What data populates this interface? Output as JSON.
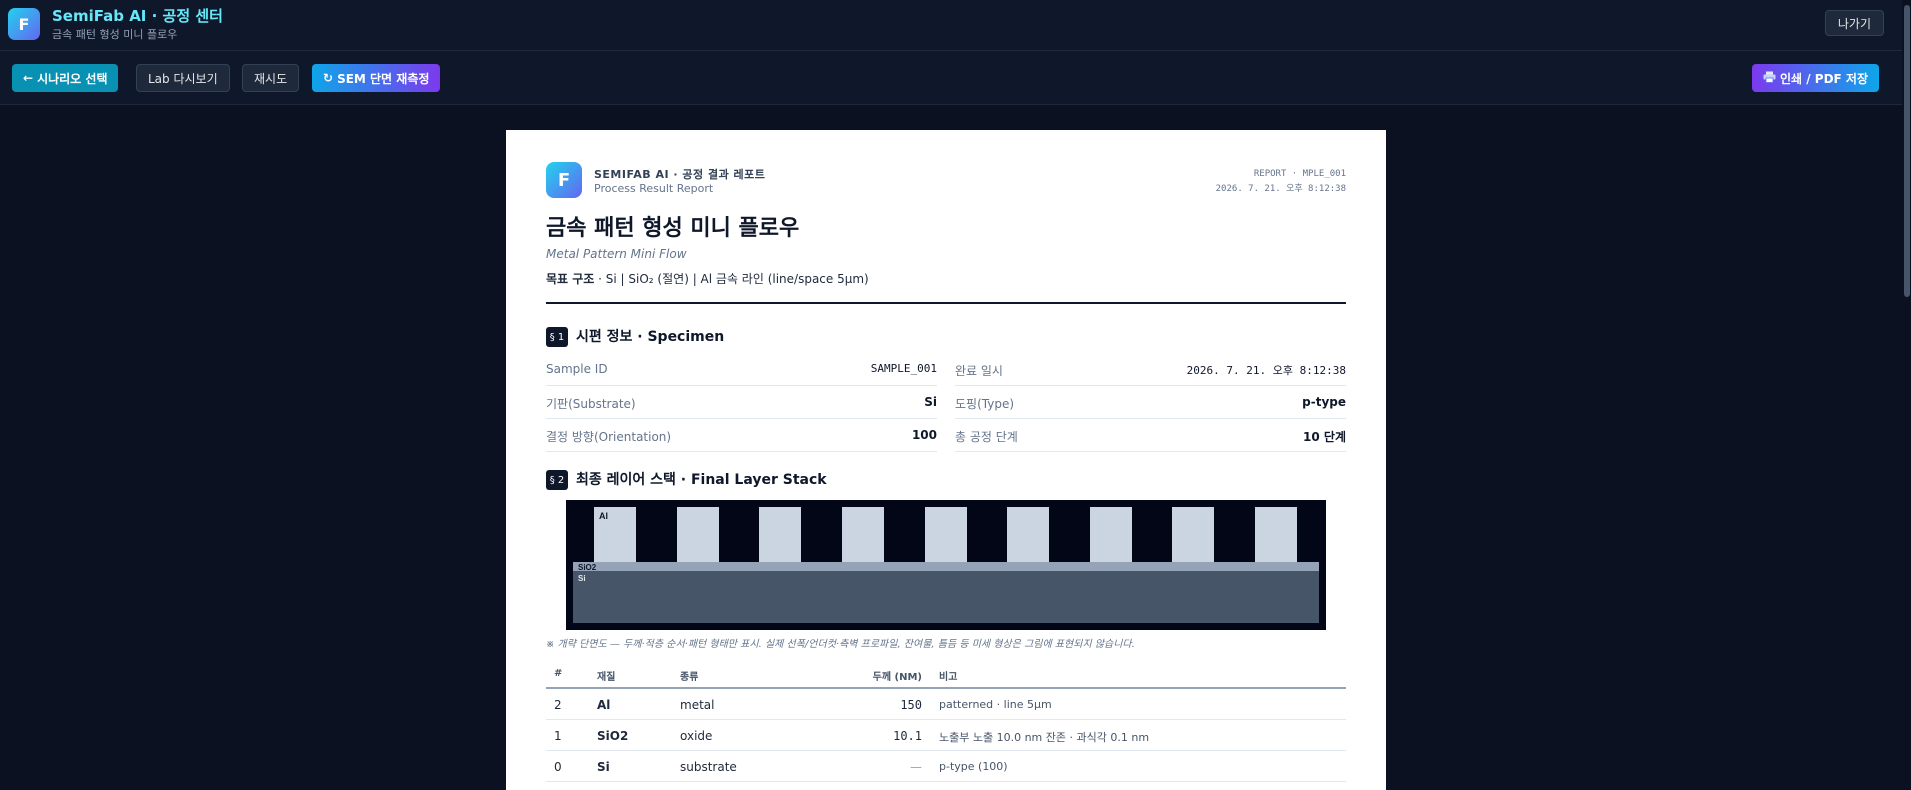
{
  "app": {
    "logo_letter": "F",
    "title": "SemiFab AI · 공정 센터",
    "subtitle": "금속 패턴 형성 미니 플로우",
    "exit_label": "나가기"
  },
  "toolbar": {
    "scenario_icon": "←",
    "scenario_label": "시나리오 선택",
    "lab_label": "Lab 다시보기",
    "retry_label": "재시도",
    "sem_icon": "↻",
    "sem_label": "SEM 단면 재측정",
    "print_icon": "printer-icon",
    "print_label": "인쇄 / PDF 저장"
  },
  "report": {
    "logo_letter": "F",
    "brand": "SEMIFAB AI · 공정 결과 레포트",
    "brand_sub": "Process Result Report",
    "report_id": "REPORT · MPLE_001",
    "timestamp": "2026. 7. 21. 오후 8:12:38",
    "title": "금속 패턴 형성 미니 플로우",
    "title_en": "Metal Pattern Mini Flow",
    "target_label": "목표 구조",
    "target_value": " · Si | SiO₂ (절연) | Al 금속 라인 (line/space 5µm)",
    "section1": {
      "badge": "§ 1",
      "title": "시편 정보 · Specimen",
      "left": [
        {
          "key": "Sample ID",
          "value": "SAMPLE_001"
        },
        {
          "key": "기판(Substrate)",
          "value": "Si"
        },
        {
          "key": "결정 방향(Orientation)",
          "value": "100"
        }
      ],
      "right": [
        {
          "key": "완료 일시",
          "value": "2026. 7. 21. 오후 8:12:38"
        },
        {
          "key": "도핑(Type)",
          "value": "p-type"
        },
        {
          "key": "총 공정 단계",
          "value": "10 단계"
        }
      ]
    },
    "section2": {
      "badge": "§ 2",
      "title": "최종 레이어 스택 · Final Layer Stack",
      "layer_labels": {
        "al": "Al",
        "sio2": "SiO2",
        "si": "Si"
      },
      "caption": "※ 개략 단면도 — 두께·적층 순서·패턴 형태만 표시. 실제 선폭/언더컷·측벽 프로파일, 잔여물, 틈듬 등 미세 형상은 그림에 표현되지 않습니다.",
      "table": {
        "headers": {
          "idx": "#",
          "material": "재질",
          "kind": "종류",
          "thickness": "두께 (NM)",
          "note": "비고"
        },
        "rows": [
          {
            "idx": "2",
            "material": "Al",
            "kind": "metal",
            "thickness": "150",
            "note": "patterned · line 5µm"
          },
          {
            "idx": "1",
            "material": "SiO2",
            "kind": "oxide",
            "thickness": "10.1",
            "note": "노출부 노출 10.0 nm 잔존 · 과식각 0.1 nm"
          },
          {
            "idx": "0",
            "material": "Si",
            "kind": "substrate",
            "thickness": "—",
            "note": "p-type (100)"
          }
        ]
      }
    }
  },
  "colors": {
    "accent_cyan": "#0891b2",
    "accent_purple": "#7c3aed",
    "al_layer": "#cbd5e1",
    "sio2_layer": "#94a3b8",
    "si_layer": "#475569"
  }
}
